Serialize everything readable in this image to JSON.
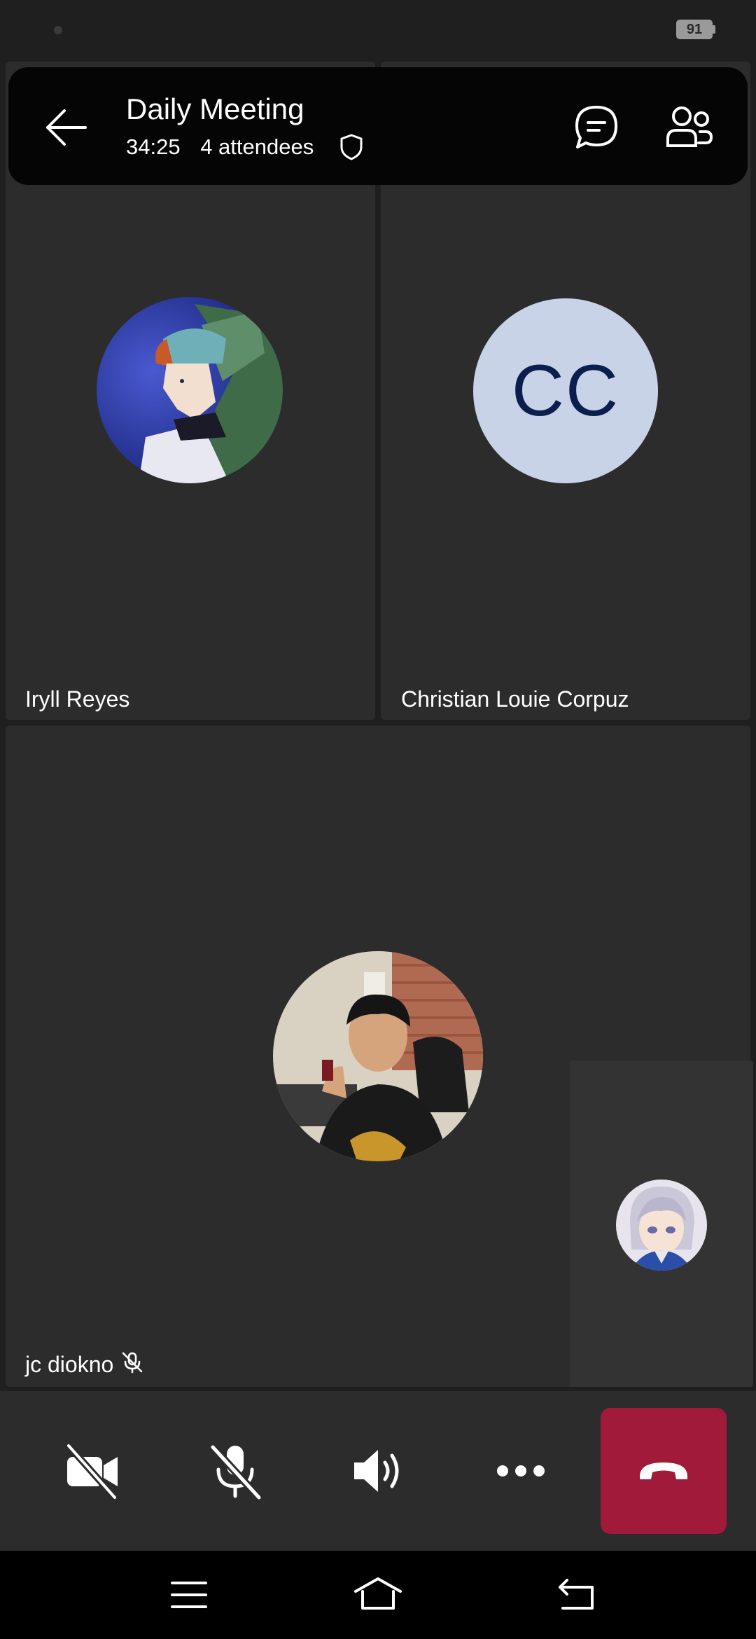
{
  "status_bar": {
    "battery": "91"
  },
  "header": {
    "title": "Daily Meeting",
    "duration": "34:25",
    "attendees": "4 attendees"
  },
  "participants": [
    {
      "name": "Iryll Reyes"
    },
    {
      "name": "Christian Louie Corpuz",
      "initials": "CC"
    },
    {
      "name": "jc diokno",
      "muted": true
    }
  ],
  "colors": {
    "tile_bg": "#2c2c2c",
    "header_bg": "#050505",
    "initials_avatar_bg": "#c9d3e8",
    "initials_text": "#0a1f4e",
    "hangup_bg": "#a21a3a"
  },
  "controls": {
    "icons": [
      "video-off-icon",
      "mic-off-icon",
      "speaker-icon",
      "more-icon",
      "hang-up-icon"
    ]
  },
  "nav": {
    "icons": [
      "menu-icon",
      "home-icon",
      "back-icon"
    ]
  }
}
